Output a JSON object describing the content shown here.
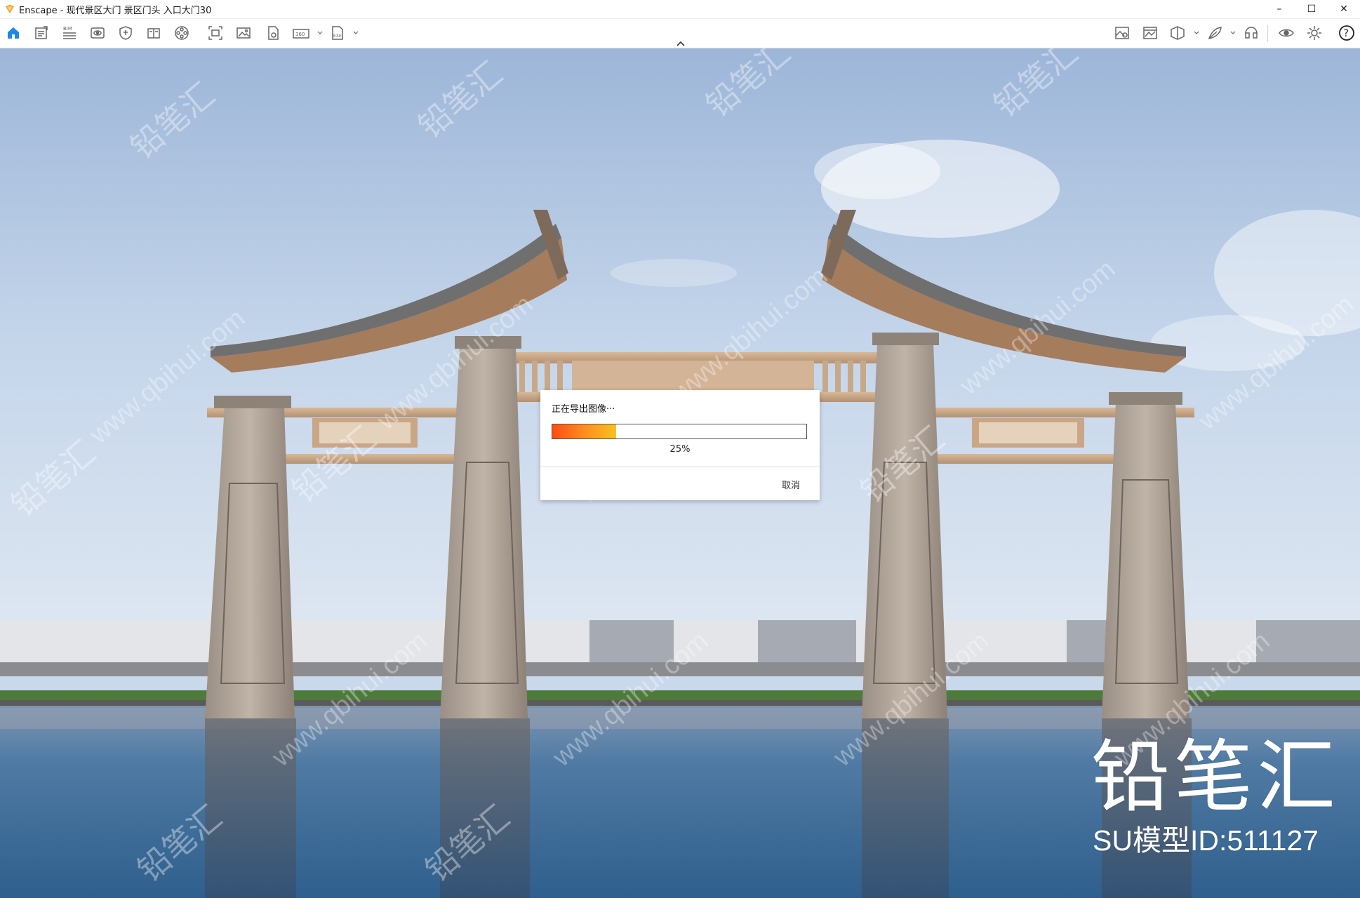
{
  "window": {
    "title": "Enscape - 现代景区大门 景区门头 入口大门30",
    "minimize": "–",
    "maximize": "☐",
    "close": "✕"
  },
  "toolbar": {
    "left_icons": [
      "home-icon",
      "document-icon",
      "bim-icon",
      "view-icon",
      "shield-icon",
      "book-icon",
      "video-icon",
      "capture-icon",
      "image-icon",
      "asset-icon",
      "panorama-360-icon",
      "export-exe-icon"
    ],
    "right_icons": [
      "map-icon",
      "image-panel-icon",
      "cube-icon",
      "feather-icon",
      "headset-icon",
      "eye-icon",
      "settings-icon",
      "help-icon"
    ],
    "bim_label": "BIM",
    "pano_label": "360",
    "exe_label": "EXE",
    "help_label": "?"
  },
  "dialog": {
    "title": "正在导出图像···",
    "progress": 0.25,
    "progress_text": "25%",
    "cancel_label": "取消"
  },
  "watermark": {
    "brand": "铅笔汇",
    "model_id": "SU模型ID:511127",
    "small_text": "铅笔汇",
    "url_text": "www.qbihui.com"
  },
  "colors": {
    "progress_start": "#ff4b16",
    "progress_end": "#f5c222",
    "accent": "#1e88e5"
  }
}
